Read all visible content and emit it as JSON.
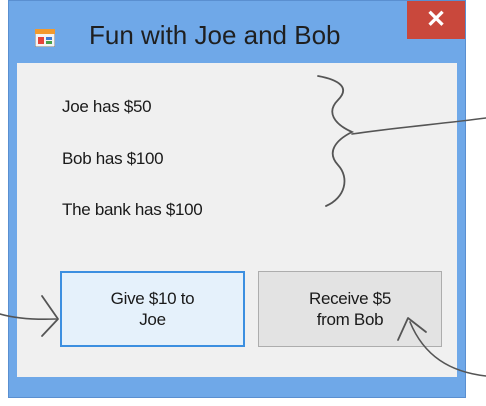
{
  "window": {
    "title": "Fun with Joe and Bob",
    "close_glyph": "✕",
    "icon": "app-window-icon"
  },
  "labels": {
    "joe": "Joe has $50",
    "bob": "Bob has $100",
    "bank": "The bank has $100"
  },
  "buttons": {
    "give": {
      "line1": "Give $10 to",
      "line2": "Joe"
    },
    "receive": {
      "line1": "Receive $5",
      "line2": "from Bob"
    }
  },
  "colors": {
    "window_frame": "#6fa8e8",
    "client_background": "#f0f0f0",
    "close_button": "#c9483c",
    "focused_button_border": "#3c8fe0",
    "annotation_ink": "#555555"
  }
}
